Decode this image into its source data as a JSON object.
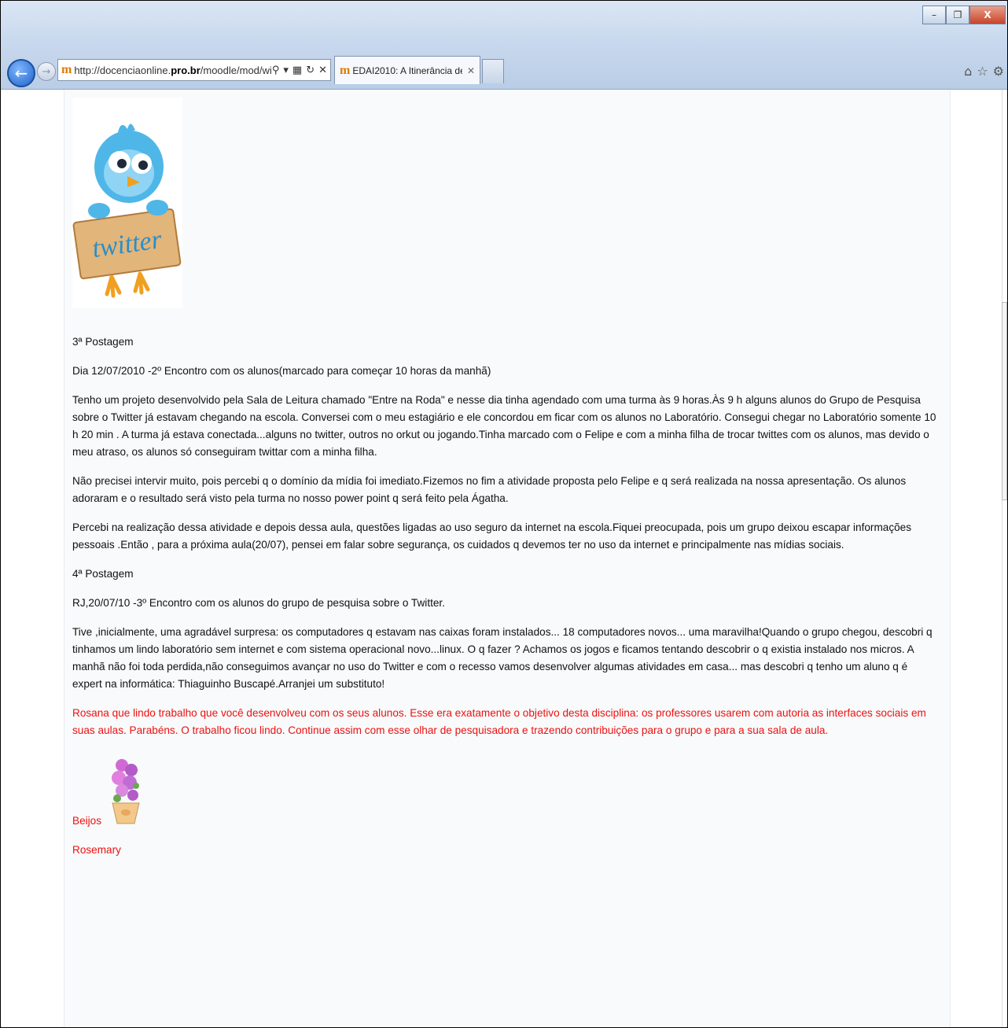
{
  "browser": {
    "url_prefix": "http://docenciaonline.",
    "url_domain": "pro.br",
    "url_suffix": "/moodle/mod/wiki",
    "tab_title": "EDAI2010: A Itinerância de ...",
    "window_controls": [
      "minimize-icon",
      "restore-icon",
      "close-icon"
    ],
    "toolbar_icons": [
      "home-icon",
      "star-icon",
      "gear-icon"
    ]
  },
  "content": {
    "image_alt": "twitter",
    "post3_heading": "3ª Postagem",
    "post3_date": "Dia 12/07/2010 -2º Encontro com os alunos(marcado para começar 10 horas da manhã)",
    "post3_p1": "Tenho um projeto desenvolvido pela Sala de Leitura chamado \"Entre na Roda\" e nesse dia tinha agendado com uma turma às 9 horas.Às 9 h alguns alunos do Grupo de Pesquisa sobre o Twitter já estavam chegando na escola. Conversei com o meu estagiário e ele concordou em ficar com os alunos no Laboratório. Consegui chegar no Laboratório somente 10 h 20 min . A turma já estava conectada...alguns no twitter, outros no orkut ou jogando.Tinha marcado com o Felipe e com a minha filha de trocar twittes com os alunos, mas devido o meu atraso, os alunos só conseguiram twittar com a minha filha.",
    "post3_p2": "Não precisei intervir muito, pois percebi q o domínio da mídia foi imediato.Fizemos no fim a atividade proposta pelo Felipe e q será realizada na nossa apresentação. Os alunos adoraram e o resultado será visto pela turma no nosso power point q será feito pela Ágatha.",
    "post3_p3": "Percebi na realização dessa atividade e depois dessa aula, questões ligadas ao uso seguro da internet na escola.Fiquei preocupada, pois um grupo deixou escapar informações pessoais .Então , para a próxima aula(20/07), pensei em falar sobre segurança, os cuidados q devemos ter no uso da internet e principalmente nas mídias sociais.",
    "post4_heading": "4ª Postagem",
    "post4_date": "RJ,20/07/10 -3º Encontro com os alunos do grupo de pesquisa sobre o Twitter.",
    "post4_p1": "Tive ,inicialmente, uma agradável surpresa: os computadores q estavam nas caixas foram instalados... 18 computadores novos... uma maravilha!Quando o grupo chegou, descobri q tinhamos um lindo laboratório sem internet e com sistema operacional novo...linux. O q fazer ? Achamos os jogos e ficamos tentando descobrir o q existia instalado nos micros. A manhã não foi toda perdida,não conseguimos avançar no uso do Twitter e com o recesso vamos desenvolver algumas atividades em casa... mas descobri q tenho um aluno q é expert na informática: Thiaguinho Buscapé.Arranjei um substituto!",
    "comment": "Rosana que lindo trabalho que você desenvolveu com os seus alunos. Esse era exatamente o objetivo desta disciplina: os professores usarem com autoria as interfaces sociais em suas aulas. Parabéns. O trabalho ficou lindo. Continue assim com esse olhar de pesquisadora e trazendo contribuições para o grupo e para a sua sala de aula.",
    "closing": "Beijos",
    "signature": "Rosemary"
  },
  "colors": {
    "comment_text": "#ee1111",
    "body_text": "#111111",
    "content_bg": "#f8fafb"
  }
}
